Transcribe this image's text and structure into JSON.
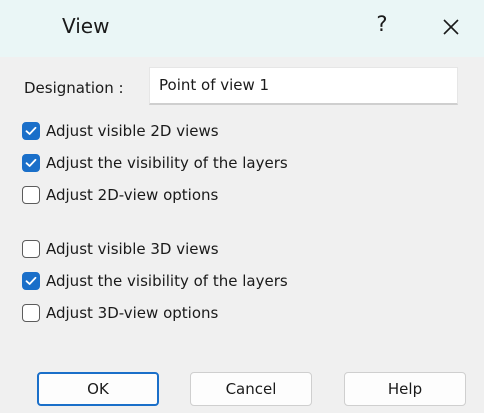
{
  "dialog": {
    "title": "View",
    "help_label": "?",
    "close_icon": "close-icon"
  },
  "designation": {
    "label": "Designation :",
    "value": "Point of view 1"
  },
  "options_2d": [
    {
      "label": "Adjust visible 2D views",
      "checked": true
    },
    {
      "label": "Adjust the visibility of the layers",
      "checked": true
    },
    {
      "label": "Adjust 2D-view options",
      "checked": false
    }
  ],
  "options_3d": [
    {
      "label": "Adjust visible 3D views",
      "checked": false
    },
    {
      "label": "Adjust the visibility of the layers",
      "checked": true
    },
    {
      "label": "Adjust 3D-view options",
      "checked": false
    }
  ],
  "buttons": {
    "ok": "OK",
    "cancel": "Cancel",
    "help": "Help"
  },
  "colors": {
    "accent": "#1a6fc9",
    "titlebar": "#eaf6f6",
    "background": "#f0f0f0"
  }
}
